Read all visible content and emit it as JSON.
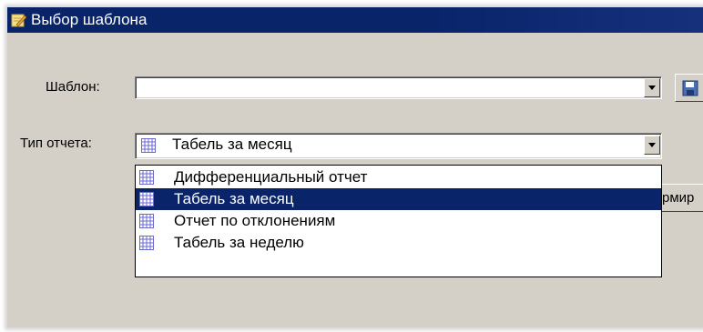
{
  "window": {
    "title": "Выбор шаблона"
  },
  "form": {
    "template_label": "Шаблон:",
    "template_value": "",
    "report_type_label": "Тип отчета:",
    "report_type_value": "Табель за месяц",
    "right_button_partial_text": "рмир"
  },
  "dropdown": {
    "items": [
      {
        "label": "Дифференциальный отчет",
        "selected": false
      },
      {
        "label": "Табель за месяц",
        "selected": true
      },
      {
        "label": "Отчет по отклонениям",
        "selected": false
      },
      {
        "label": "Табель за неделю",
        "selected": false
      }
    ]
  },
  "colors": {
    "titlebar": "#0a246a",
    "selection": "#0a246a",
    "dialog_bg": "#d4d0c8",
    "grid_icon": "#6a6ad0"
  },
  "icons": {
    "app": "edit-pencil-icon",
    "save": "floppy-disk-icon",
    "report_type": "grid-table-icon"
  }
}
